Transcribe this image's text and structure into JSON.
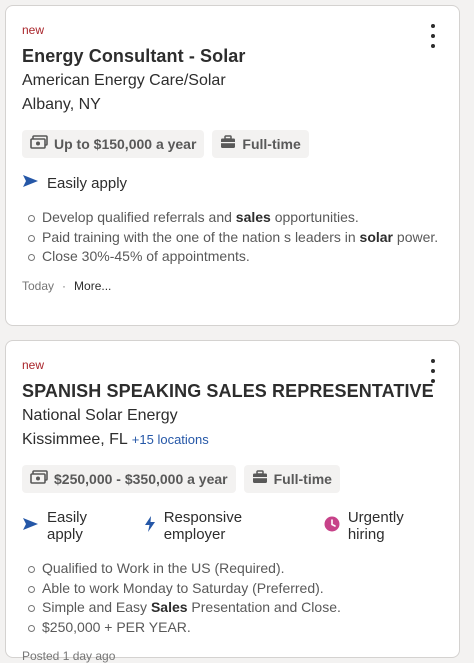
{
  "colors": {
    "new_tag": "#a9252b",
    "link": "#2557a7",
    "apply_icon": "#2557a7",
    "urgent_icon": "#c74289"
  },
  "jobs": [
    {
      "new_label": "new",
      "title": "Energy Consultant - Solar",
      "company": "American Energy Care/Solar",
      "location": "Albany, NY",
      "salary": "Up to $150,000 a year",
      "job_type": "Full-time",
      "easily_apply": "Easily apply",
      "bullets": [
        {
          "pre": "Develop qualified referrals and ",
          "bold": "sales",
          "post": " opportunities."
        },
        {
          "pre": "Paid training with the one of the nation s leaders in ",
          "bold": "solar",
          "post": " power."
        },
        {
          "pre": "Close 30%-45% of appointments.",
          "bold": "",
          "post": ""
        }
      ],
      "posted": "Today",
      "more": "More..."
    },
    {
      "new_label": "new",
      "title": "SPANISH SPEAKING SALES REPRESENTATIVE",
      "company": "National Solar Energy",
      "location": "Kissimmee, FL",
      "more_locations": "+15 locations",
      "salary": "$250,000 - $350,000 a year",
      "job_type": "Full-time",
      "easily_apply": "Easily apply",
      "responsive": "Responsive employer",
      "urgent": "Urgently hiring",
      "bullets": [
        {
          "pre": "Qualified to Work in the US (Required).",
          "bold": "",
          "post": ""
        },
        {
          "pre": "Able to work Monday to Saturday (Preferred).",
          "bold": "",
          "post": ""
        },
        {
          "pre": "Simple and Easy ",
          "bold": "Sales",
          "post": " Presentation and Close."
        },
        {
          "pre": "$250,000 + PER YEAR.",
          "bold": "",
          "post": ""
        }
      ],
      "posted": "Posted 1 day ago"
    }
  ]
}
